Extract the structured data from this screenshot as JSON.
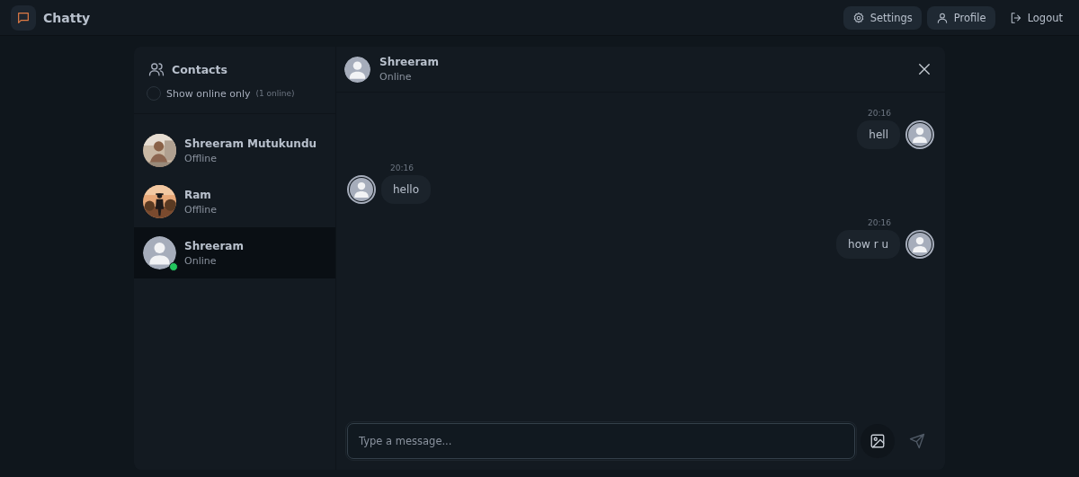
{
  "navbar": {
    "app_name": "Chatty",
    "buttons": [
      {
        "kind": "settings",
        "label": "Settings",
        "filled": true
      },
      {
        "kind": "profile",
        "label": "Profile",
        "filled": true
      },
      {
        "kind": "logout",
        "label": "Logout",
        "filled": false
      }
    ]
  },
  "sidebar": {
    "title": "Contacts",
    "filter": {
      "label": "Show online only",
      "checked": false,
      "count": "(1 online)"
    },
    "contacts": [
      {
        "name": "Shreeram Mutukundu",
        "status": "Offline",
        "online": false,
        "selected": false
      },
      {
        "name": "Ram",
        "status": "Offline",
        "online": false,
        "selected": false
      },
      {
        "kind": "plain",
        "name": "Shreeram",
        "status": "Online",
        "online": true,
        "selected": true
      }
    ]
  },
  "chat": {
    "header": {
      "name": "Shreeram",
      "status": "Online"
    },
    "messages": [
      {
        "kind": "outgoing",
        "time": "20:16",
        "text": "hell"
      },
      {
        "kind": "incoming",
        "time": "20:16",
        "text": "hello"
      },
      {
        "kind": "outgoing",
        "time": "20:16",
        "text": "how r u"
      }
    ],
    "input": {
      "placeholder": "Type a message..."
    }
  }
}
